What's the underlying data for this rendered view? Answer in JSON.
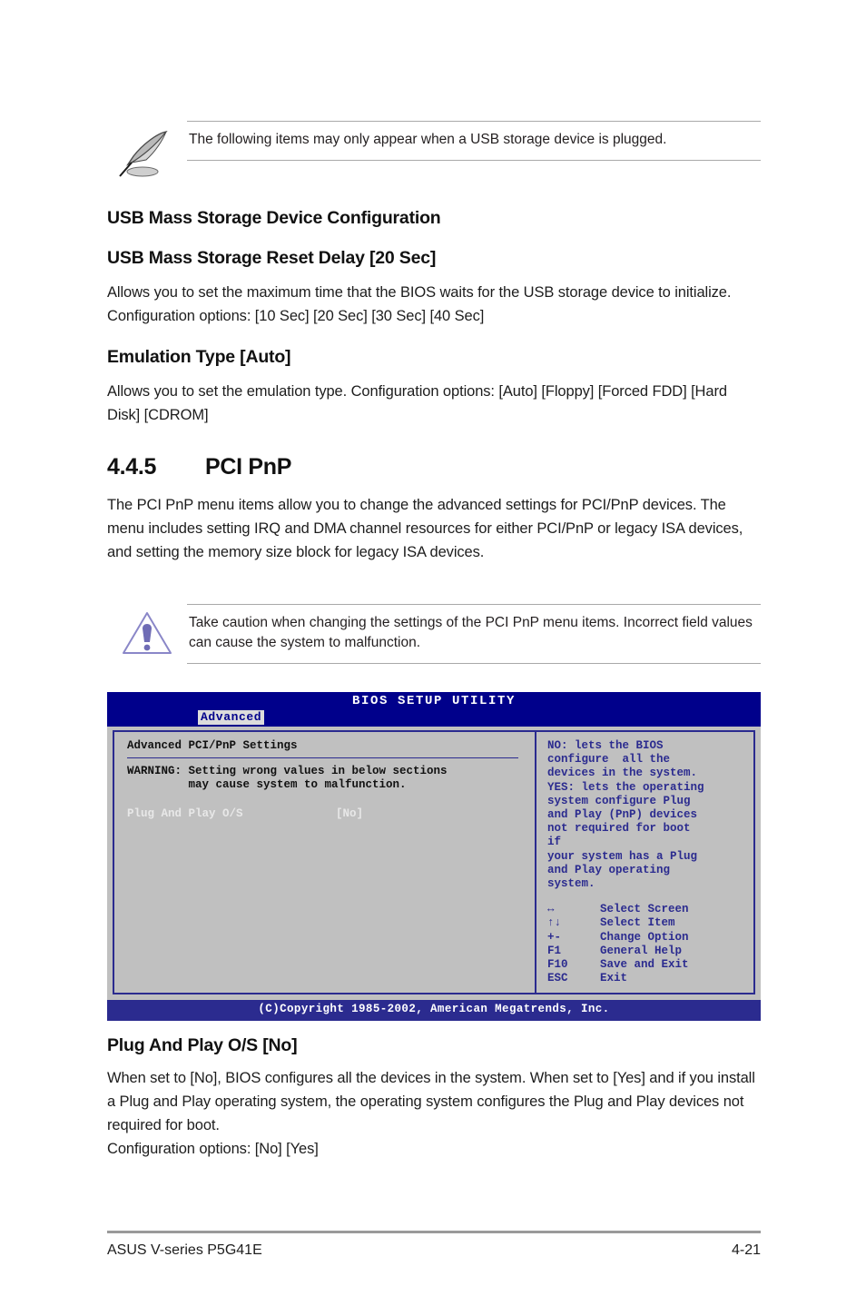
{
  "note": {
    "icon": "quill-pen-icon",
    "text": "The following items may only appear when a USB storage device is plugged."
  },
  "caution": {
    "icon": "warning-triangle-icon",
    "text": "Take caution when changing the settings of the PCI PnP menu items. Incorrect field values can cause the system to malfunction."
  },
  "usb": {
    "group_heading": "USB Mass Storage Device Configuration",
    "item1_heading": "USB Mass Storage Reset Delay [20 Sec]",
    "item1_body": "Allows you to set the maximum time that the BIOS waits for the USB storage device to initialize. Configuration options: [10 Sec] [20 Sec] [30 Sec] [40 Sec]",
    "item2_heading": "Emulation Type [Auto]",
    "item2_body": "Allows you to set the emulation type. Configuration options: [Auto] [Floppy] [Forced FDD] [Hard Disk] [CDROM]"
  },
  "section": {
    "number": "4.4.5",
    "title": "PCI PnP",
    "body": "The PCI PnP menu items allow you to change the advanced settings for PCI/PnP devices. The menu includes setting IRQ and DMA channel resources for either PCI/PnP or legacy ISA devices, and setting the memory size block for legacy ISA devices."
  },
  "bios": {
    "title": "BIOS SETUP UTILITY",
    "tab": "Advanced",
    "main_heading": "Advanced PCI/PnP Settings",
    "warning_line1": "WARNING: Setting wrong values in below sections",
    "warning_line2": "         may cause system to malfunction.",
    "row_label": "Plug And Play O/S",
    "row_value": "[No]",
    "help_lines": [
      "NO: lets the BIOS",
      "configure  all the",
      "devices in the system.",
      "YES: lets the operating",
      "system configure Plug",
      "and Play (PnP) devices",
      "not required for boot",
      "if",
      "your system has a Plug",
      "and Play operating",
      "system."
    ],
    "keys": [
      {
        "key": "↔",
        "action": "Select Screen"
      },
      {
        "key": "↑↓",
        "action": "Select Item"
      },
      {
        "key": "+-",
        "action": "Change Option"
      },
      {
        "key": "F1",
        "action": "General Help"
      },
      {
        "key": "F10",
        "action": "Save and Exit"
      },
      {
        "key": "ESC",
        "action": "Exit"
      }
    ],
    "copyright": "(C)Copyright 1985-2002, American Megatrends, Inc."
  },
  "pnp": {
    "heading": "Plug And Play O/S [No]",
    "body": "When set to [No], BIOS configures all the devices in the system. When set to [Yes] and if you install a Plug and Play operating system, the operating system configures the Plug and Play devices not required for boot.",
    "options": "Configuration options: [No] [Yes]"
  },
  "footer": {
    "left": "ASUS V-series P5G41E",
    "right": "4-21"
  },
  "colors": {
    "bios_titlebar": "#00008b",
    "bios_panel": "#c0c0c0",
    "bios_border": "#2b2b8f",
    "caution_icon": "#8a87c8"
  }
}
